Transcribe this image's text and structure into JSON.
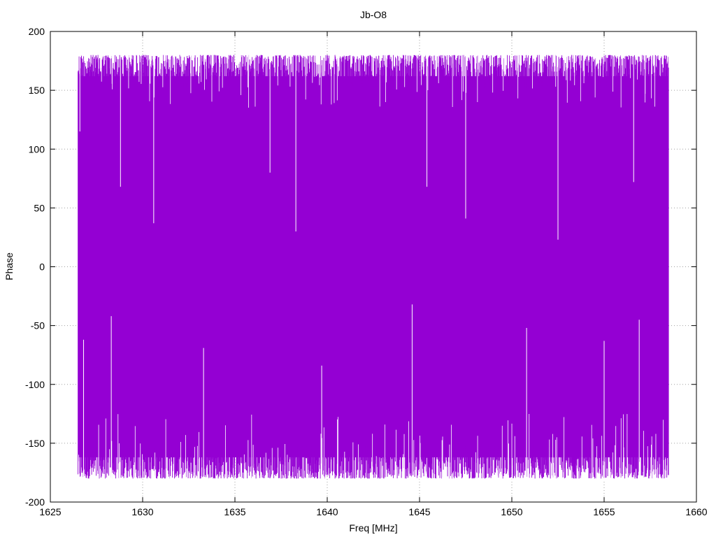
{
  "chart_data": {
    "type": "line",
    "title": "Jb-O8",
    "xlabel": "Freq [MHz]",
    "ylabel": "Phase",
    "xlim": [
      1625,
      1660
    ],
    "ylim": [
      -200,
      200
    ],
    "xticks": [
      "1625",
      "1630",
      "1635",
      "1640",
      "1645",
      "1650",
      "1655",
      "1660"
    ],
    "yticks": [
      "-200",
      "-150",
      "-100",
      "-50",
      "0",
      "50",
      "100",
      "150",
      "200"
    ],
    "grid": true,
    "legend": "none",
    "series": [
      {
        "color": "#9400d3",
        "x_start": 1626.5,
        "x_end": 1658.5,
        "y_range": [
          -180,
          180
        ],
        "notable_spikes": [
          {
            "x": 1626.6,
            "y": 115
          },
          {
            "x": 1626.8,
            "y": -62
          },
          {
            "x": 1628.3,
            "y": -42
          },
          {
            "x": 1628.8,
            "y": 68
          },
          {
            "x": 1630.6,
            "y": 37
          },
          {
            "x": 1633.3,
            "y": -69
          },
          {
            "x": 1636.9,
            "y": 80
          },
          {
            "x": 1638.3,
            "y": 30
          },
          {
            "x": 1639.7,
            "y": -84
          },
          {
            "x": 1644.6,
            "y": -32
          },
          {
            "x": 1645.4,
            "y": 68
          },
          {
            "x": 1647.5,
            "y": 41
          },
          {
            "x": 1650.8,
            "y": -52
          },
          {
            "x": 1652.5,
            "y": 23
          },
          {
            "x": 1655.0,
            "y": -63
          },
          {
            "x": 1656.6,
            "y": 72
          },
          {
            "x": 1656.9,
            "y": -45
          }
        ]
      }
    ]
  }
}
